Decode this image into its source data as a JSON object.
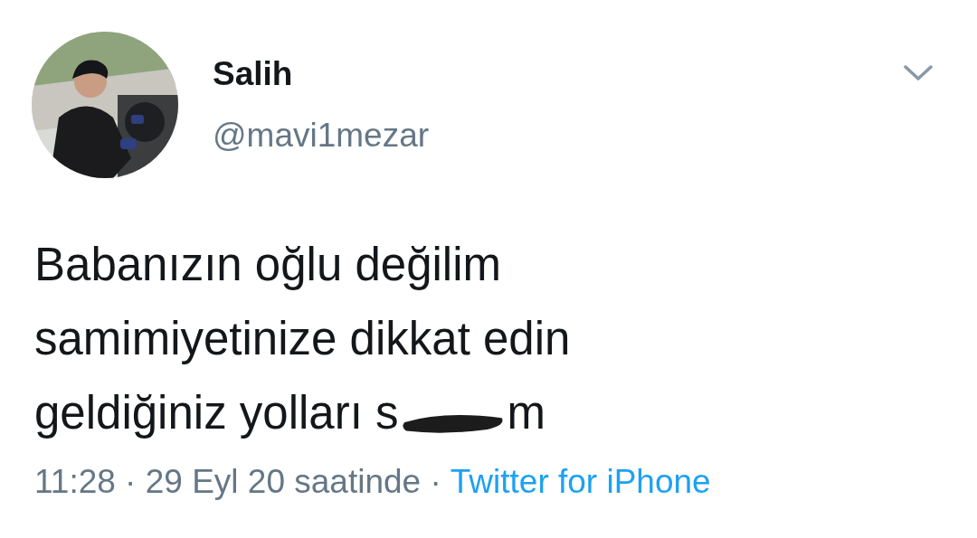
{
  "user": {
    "name": "Salih",
    "handle": "@mavi1mezar"
  },
  "tweet": {
    "lines": [
      {
        "text": "Babanızın oğlu değilim"
      },
      {
        "text": "samimiyetinize dikkat edin"
      },
      {
        "text": "geldiğiniz yolları s",
        "censor_mark": true,
        "after": "m"
      }
    ],
    "meta": "11:28 · 29 Eyl 20 saatinde ·",
    "source": "Twitter for iPhone"
  }
}
